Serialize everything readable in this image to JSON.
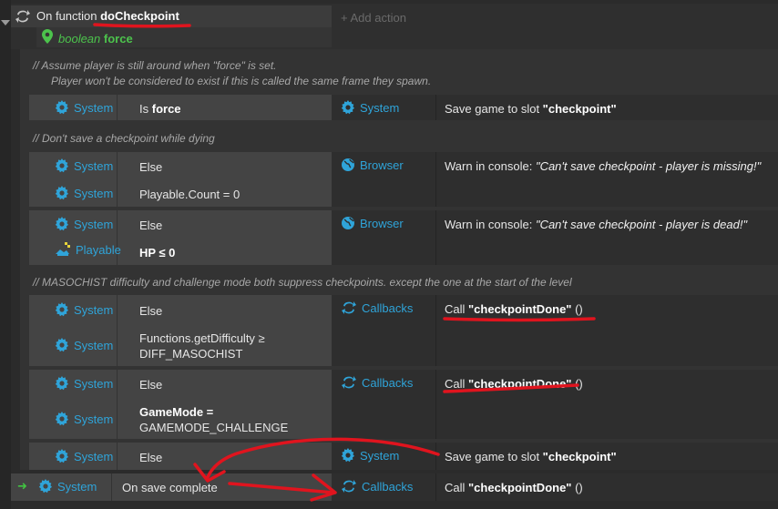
{
  "function_block": {
    "prefix": "On function ",
    "name": "doCheckpoint",
    "add_action": "+ Add action",
    "param_type": "boolean",
    "param_name": "force"
  },
  "comments": [
    "//  Assume player is still around when \"force\" is set.",
    "Player won't be considered to exist if this is called the same frame they spawn.",
    "//  Don't save a checkpoint while dying",
    "//  MASOCHIST difficulty and challenge mode both suppress checkpoints. except the one at the start of the level"
  ],
  "labels": {
    "system": "System",
    "browser": "Browser",
    "callbacks": "Callbacks",
    "playable": "Playable",
    "else": "Else"
  },
  "rows": {
    "r1": {
      "cond_pre": "Is ",
      "cond_b": "force",
      "act_pre": "Save game to slot ",
      "act_str": "\"checkpoint\""
    },
    "r2": {
      "cond2": "Playable.Count = 0",
      "act_pre": "Warn in console: ",
      "act_str": "\"Can't save checkpoint - player is missing!\""
    },
    "r3": {
      "cond2": "HP ≤ 0",
      "act_pre": "Warn in console: ",
      "act_str": "\"Can't save checkpoint - player is dead!\""
    },
    "r4": {
      "cond2_a": "Functions.getDifficulty ≥",
      "cond2_b": "DIFF_MASOCHIST",
      "act_pre": "Call ",
      "act_str": "\"checkpointDone\"",
      "act_post": " ()"
    },
    "r5": {
      "cond2_a": "GameMode =",
      "cond2_b": "GAMEMODE_CHALLENGE",
      "act_pre": "Call ",
      "act_str": "\"checkpointDone\"",
      "act_post": " ()"
    },
    "r6": {
      "act_pre": "Save game to slot ",
      "act_str": "\"checkpoint\""
    },
    "r7": {
      "cond": "On save complete",
      "act_pre": "Call ",
      "act_str": "\"checkpointDone\"",
      "act_post": " ()"
    }
  },
  "colors": {
    "object_blue": "#2fa4d9",
    "param_green": "#4cc34c",
    "annotation_red": "#e0141e",
    "trigger_green": "#41c341"
  }
}
